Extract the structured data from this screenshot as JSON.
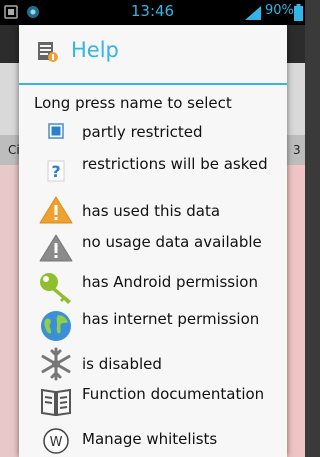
{
  "status_bar": {
    "time": "13:46",
    "battery_percent": "90%"
  },
  "background": {
    "left_label": "Ci",
    "right_label": "3"
  },
  "dialog": {
    "title": "Help",
    "intro": "Long press name to select",
    "items": [
      {
        "icon": "partly-restricted-icon",
        "label": "partly restricted"
      },
      {
        "icon": "question-icon",
        "label": "restrictions will be asked"
      },
      {
        "icon": "warning-orange-icon",
        "label": "has used this data"
      },
      {
        "icon": "warning-grey-icon",
        "label": "no usage data available"
      },
      {
        "icon": "key-icon",
        "label": "has Android permission"
      },
      {
        "icon": "globe-icon",
        "label": "has internet permission"
      },
      {
        "icon": "snowflake-icon",
        "label": "is disabled"
      },
      {
        "icon": "book-icon",
        "label": "Function documentation"
      },
      {
        "icon": "whitelist-icon",
        "label": "Manage whitelists"
      }
    ]
  },
  "colors": {
    "accent": "#33b5e5",
    "warning": "#f0a030",
    "grey": "#8a8a8a",
    "key_green": "#8fbf2a"
  }
}
